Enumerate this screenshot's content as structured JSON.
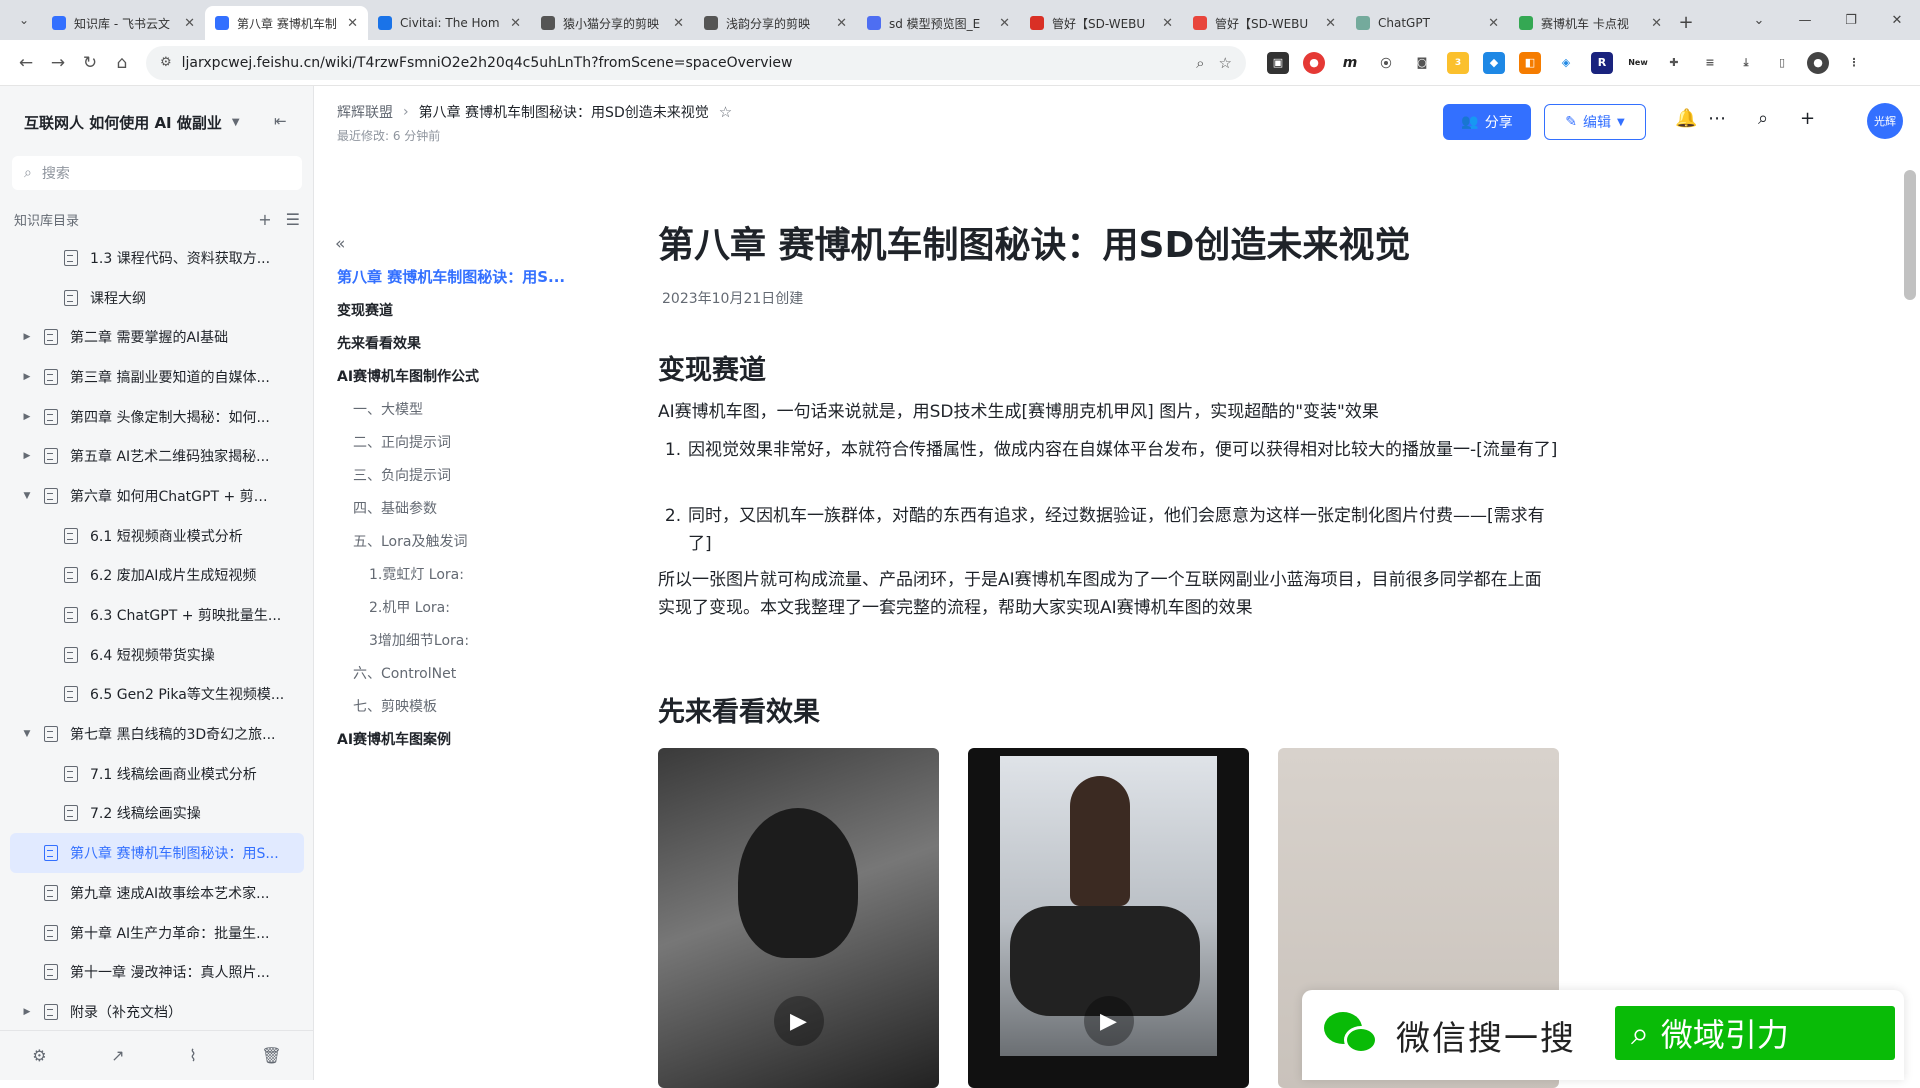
{
  "browser": {
    "tabs": [
      {
        "title": "知识库 - 飞书云文",
        "fav": "#3370ff",
        "active": false
      },
      {
        "title": "第八章 赛博机车制",
        "fav": "#3370ff",
        "active": true
      },
      {
        "title": "Civitai: The Hom",
        "fav": "#1a73e8",
        "active": false
      },
      {
        "title": "猿小猫分享的剪映",
        "fav": "#555555",
        "active": false
      },
      {
        "title": "浅韵分享的剪映",
        "fav": "#555555",
        "active": false
      },
      {
        "title": "sd 模型预览图_E",
        "fav": "#4e6ef2",
        "active": false
      },
      {
        "title": "管好【SD-WEBU",
        "fav": "#d93025",
        "active": false
      },
      {
        "title": "管好【SD-WEBU",
        "fav": "#e8453c",
        "active": false
      },
      {
        "title": "ChatGPT",
        "fav": "#74aa9c",
        "active": false
      },
      {
        "title": "赛博机车 卡点视",
        "fav": "#34a853",
        "active": false
      }
    ],
    "url": "ljarxpcwej.feishu.cn/wiki/T4rzwFsmniO2e2h20q4c5uhLnTh?fromScene=spaceOverview",
    "extension_badges": [
      "3",
      "New"
    ]
  },
  "sidebar": {
    "title": "互联网人 如何使用 AI 做副业",
    "search_placeholder": "搜索",
    "section_label": "知识库目录",
    "items": [
      {
        "label": "1.3 课程代码、资料获取方...",
        "level": 2,
        "arrow": ""
      },
      {
        "label": "课程大纲",
        "level": 2,
        "arrow": ""
      },
      {
        "label": "第二章 需要掌握的AI基础",
        "level": 1,
        "arrow": "▶"
      },
      {
        "label": "第三章 搞副业要知道的自媒体...",
        "level": 1,
        "arrow": "▶"
      },
      {
        "label": "第四章 头像定制大揭秘：如何...",
        "level": 1,
        "arrow": "▶"
      },
      {
        "label": "第五章 AI艺术二维码独家揭秘...",
        "level": 1,
        "arrow": "▶"
      },
      {
        "label": "第六章 如何用ChatGPT + 剪映...",
        "level": 1,
        "arrow": "▼"
      },
      {
        "label": "6.1 短视频商业模式分析",
        "level": 2,
        "arrow": ""
      },
      {
        "label": "6.2 废加AI成片生成短视频",
        "level": 2,
        "arrow": ""
      },
      {
        "label": "6.3 ChatGPT + 剪映批量生...",
        "level": 2,
        "arrow": ""
      },
      {
        "label": "6.4 短视频带货实操",
        "level": 2,
        "arrow": ""
      },
      {
        "label": "6.5 Gen2 Pika等文生视频模...",
        "level": 2,
        "arrow": ""
      },
      {
        "label": "第七章 黑白线稿的3D奇幻之旅...",
        "level": 1,
        "arrow": "▼"
      },
      {
        "label": "7.1 线稿绘画商业模式分析",
        "level": 2,
        "arrow": ""
      },
      {
        "label": "7.2 线稿绘画实操",
        "level": 2,
        "arrow": ""
      },
      {
        "label": "第八章 赛博机车制图秘诀：用S...",
        "level": 1,
        "arrow": "",
        "active": true
      },
      {
        "label": "第九章 速成AI故事绘本艺术家...",
        "level": 1,
        "arrow": ""
      },
      {
        "label": "第十章 AI生产力革命：批量生...",
        "level": 1,
        "arrow": ""
      },
      {
        "label": "第十一章 漫改神话：真人照片...",
        "level": 1,
        "arrow": ""
      },
      {
        "label": "附录（补充文档）",
        "level": 1,
        "arrow": "▶"
      }
    ]
  },
  "topbar": {
    "crumb_root": "辉辉联盟",
    "crumb_current": "第八章 赛博机车制图秘诀：用SD创造未来视觉",
    "modified": "最近修改: 6 分钟前",
    "share_label": "分享",
    "edit_label": "编辑",
    "avatar_text": "光辉"
  },
  "outline": [
    {
      "label": "第八章 赛博机车制图秘诀：用S...",
      "cls": "h1 active"
    },
    {
      "label": "变现赛道",
      "cls": "h1"
    },
    {
      "label": "先来看看效果",
      "cls": "h1"
    },
    {
      "label": "AI赛博机车图制作公式",
      "cls": "h1"
    },
    {
      "label": "一、大模型",
      "cls": "lv2"
    },
    {
      "label": "二、正向提示词",
      "cls": "lv2"
    },
    {
      "label": "三、负向提示词",
      "cls": "lv2"
    },
    {
      "label": "四、基础参数",
      "cls": "lv2"
    },
    {
      "label": "五、Lora及触发词",
      "cls": "lv2"
    },
    {
      "label": "1.霓虹灯 Lora:",
      "cls": "lv3"
    },
    {
      "label": "2.机甲 Lora:",
      "cls": "lv3"
    },
    {
      "label": "3增加细节Lora:",
      "cls": "lv3"
    },
    {
      "label": "六、ControlNet",
      "cls": "lv2"
    },
    {
      "label": "七、剪映模板",
      "cls": "lv2"
    },
    {
      "label": "AI赛博机车图案例",
      "cls": "h1"
    }
  ],
  "doc": {
    "title": "第八章 赛博机车制图秘诀：用SD创造未来视觉",
    "created": "2023年10月21日创建",
    "section1": "变现赛道",
    "intro": "AI赛博机车图，一句话来说就是，用SD技术生成[赛博朋克机甲风] 图片，实现超酷的\"变装\"效果",
    "list": [
      {
        "n": "1.",
        "text": "因视觉效果非常好，本就符合传播属性，做成内容在自媒体平台发布，便可以获得相对比较大的播放量一-[流量有了]"
      },
      {
        "n": "2.",
        "text": "同时，又因机车一族群体，对酷的东西有追求，经过数据验证，他们会愿意为这样一张定制化图片付费——[需求有了]"
      }
    ],
    "summary": "所以一张图片就可构成流量、产品闭环，于是AI赛博机车图成为了一个互联网副业小蓝海项目，目前很多同学都在上面实现了变现。本文我整理了一套完整的流程，帮助大家实现AI赛博机车图的效果",
    "section2": "先来看看效果"
  },
  "overlay": {
    "wechat_text": "微信搜一搜",
    "search_text": "微域引力"
  }
}
